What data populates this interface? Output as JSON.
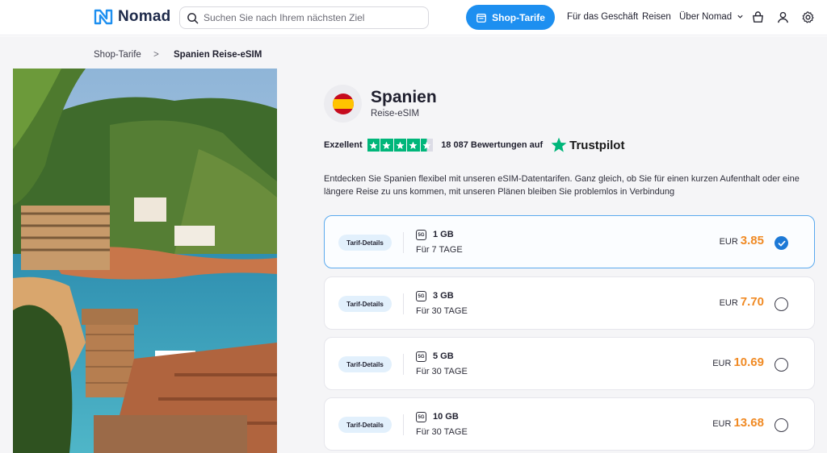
{
  "header": {
    "brand": "Nomad",
    "search_placeholder": "Suchen Sie nach Ihrem nächsten Ziel",
    "shop_button": "Shop-Tarife",
    "nav": [
      "Für das Geschäft",
      "Reisen",
      "Über Nomad"
    ]
  },
  "breadcrumb": {
    "items": [
      "Shop-Tarife",
      "Spanien Reise-eSIM"
    ],
    "separator": ">"
  },
  "product": {
    "name": "Spanien",
    "subtitle": "Reise-eSIM",
    "rating_label": "Exzellent",
    "reviews_text": "18 087 Bewertungen auf",
    "trustpilot": "Trustpilot",
    "stars": 4.5,
    "description": "Entdecken Sie Spanien flexibel mit unseren eSIM-Datentarifen. Ganz gleich, ob Sie für einen kurzen Aufenthalt oder eine längere Reise zu uns kommen, mit unseren Plänen bleiben Sie problemlos in Verbindung"
  },
  "plans": [
    {
      "details": "Tarif-Details",
      "network": "5G",
      "data": "1 GB",
      "duration": "Für 7 TAGE",
      "currency": "EUR",
      "price": "3.85",
      "selected": true
    },
    {
      "details": "Tarif-Details",
      "network": "5G",
      "data": "3 GB",
      "duration": "Für 30 TAGE",
      "currency": "EUR",
      "price": "7.70",
      "selected": false
    },
    {
      "details": "Tarif-Details",
      "network": "5G",
      "data": "5 GB",
      "duration": "Für 30 TAGE",
      "currency": "EUR",
      "price": "10.69",
      "selected": false
    },
    {
      "details": "Tarif-Details",
      "network": "5G",
      "data": "10 GB",
      "duration": "Für 30 TAGE",
      "currency": "EUR",
      "price": "13.68",
      "selected": false
    }
  ],
  "colors": {
    "accent": "#1d8ff0",
    "price": "#f08a24",
    "trustpilot_green": "#00b67a",
    "selected_border": "#5aa9ee"
  },
  "icons": {
    "search": "search-icon",
    "shop": "store-icon",
    "chevron": "chevron-down-icon",
    "cart": "basket-icon",
    "user": "user-icon",
    "settings": "gear-icon",
    "check": "check-icon"
  }
}
